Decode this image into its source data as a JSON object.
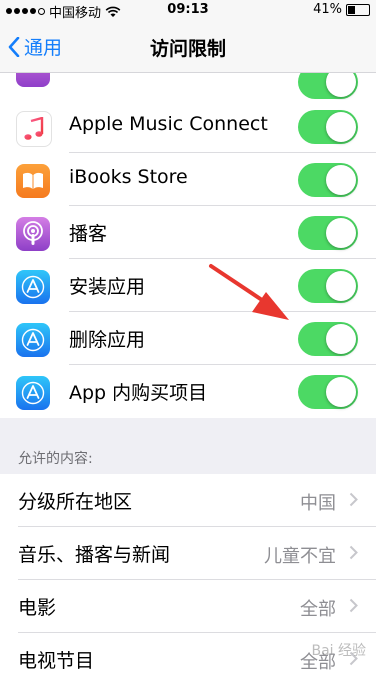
{
  "status_bar": {
    "carrier": "中国移动",
    "time": "09:13",
    "battery_percent": "41%",
    "battery_level": 0.41
  },
  "nav": {
    "back_label": "通用",
    "title": "访问限制"
  },
  "apps": [
    {
      "label": "Apple Music Connect",
      "icon": "music-icon",
      "toggle_on": true
    },
    {
      "label": "iBooks Store",
      "icon": "book-icon",
      "toggle_on": true
    },
    {
      "label": "播客",
      "icon": "podcast-icon",
      "toggle_on": true
    },
    {
      "label": "安装应用",
      "icon": "app-store-icon",
      "toggle_on": true
    },
    {
      "label": "删除应用",
      "icon": "app-store-icon",
      "toggle_on": true
    },
    {
      "label": "App 内购买项目",
      "icon": "app-store-icon",
      "toggle_on": true
    }
  ],
  "content_section": {
    "header": "允许的内容:",
    "rows": [
      {
        "label": "分级所在地区",
        "value": "中国"
      },
      {
        "label": "音乐、播客与新闻",
        "value": "儿童不宜"
      },
      {
        "label": "电影",
        "value": "全部"
      },
      {
        "label": "电视节目",
        "value": "全部"
      }
    ]
  },
  "colors": {
    "accent": "#147efb",
    "toggle_on": "#4cd964",
    "annotation_arrow": "#e8372f"
  },
  "watermark": "Bai 经验"
}
